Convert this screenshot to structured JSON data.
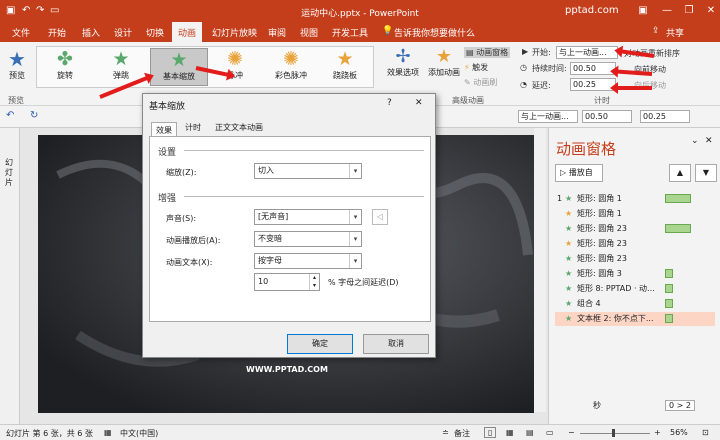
{
  "title": "运动中心.pptx - PowerPoint",
  "brand": "pptad.com",
  "share": "共享",
  "tabs": [
    "文件",
    "开始",
    "插入",
    "设计",
    "切换",
    "动画",
    "幻灯片放映",
    "审阅",
    "视图",
    "开发工具"
  ],
  "tell_me": "告诉我你想要做什么",
  "ribbon": {
    "preview": "预览",
    "preview_group": "预览",
    "animations": [
      {
        "label": "旋转",
        "color": "#5aa86c"
      },
      {
        "label": "弹跳",
        "color": "#5aa86c"
      },
      {
        "label": "基本缩放",
        "color": "#5aa86c"
      },
      {
        "label": "脉冲",
        "color": "#e8a33b"
      },
      {
        "label": "彩色脉冲",
        "color": "#e8a33b"
      },
      {
        "label": "跷跷板",
        "color": "#e8a33b"
      }
    ],
    "effect_options": "效果选项",
    "add_animation": "添加动画",
    "animation_pane": "动画窗格",
    "trigger": "触发",
    "anim_brush": "动画刷",
    "advanced_group": "高级动画",
    "start_label": "开始:",
    "start_value": "与上一动画...",
    "duration_label": "持续时间:",
    "duration_value": "00.50",
    "delay_label": "延迟:",
    "delay_value": "00.25",
    "reorder": "对动画重新排序",
    "move_earlier": "向前移动",
    "move_later": "向后移动",
    "timing_group": "计时"
  },
  "quickbar": {
    "start_value": "与上一动画...",
    "duration_value": "00.50",
    "delay_value": "00.25"
  },
  "left_strip": "幻灯片",
  "slide_text": "WWW.PPTAD.COM",
  "pane": {
    "title": "动画窗格",
    "play": "播放自",
    "items": [
      {
        "num": "1",
        "label": "矩形: 圆角 1",
        "color": "#5aa86c",
        "bar": true,
        "sel": false
      },
      {
        "num": "",
        "label": "矩形: 圆角 1",
        "color": "#e8a33b",
        "bar": false,
        "sel": false
      },
      {
        "num": "",
        "label": "矩形: 圆角 23",
        "color": "#5aa86c",
        "bar": true,
        "sel": false
      },
      {
        "num": "",
        "label": "矩形: 圆角 23",
        "color": "#e8a33b",
        "bar": false,
        "sel": false
      },
      {
        "num": "",
        "label": "矩形: 圆角 23",
        "color": "#5aa86c",
        "bar": false,
        "sel": false
      },
      {
        "num": "",
        "label": "矩形: 圆角 3",
        "color": "#5aa86c",
        "bar": true,
        "sel": false
      },
      {
        "num": "",
        "label": "矩形 8: PPTAD · 动...",
        "color": "#5aa86c",
        "bar": true,
        "sel": false
      },
      {
        "num": "",
        "label": "组合 4",
        "color": "#5aa86c",
        "bar": true,
        "sel": false
      },
      {
        "num": "",
        "label": "文本框 2: 你不点下...",
        "color": "#5aa86c",
        "bar": true,
        "sel": true
      }
    ],
    "seconds": "秒",
    "zoom_start": "0",
    "zoom_end": "2"
  },
  "dialog": {
    "title": "基本缩放",
    "help": "?",
    "tabs": [
      "效果",
      "计时",
      "正文文本动画"
    ],
    "settings": "设置",
    "zoom_label": "缩放(Z):",
    "zoom_value": "切入",
    "enhance": "增强",
    "sound_label": "声音(S):",
    "sound_value": "[无声音]",
    "after_label": "动画播放后(A):",
    "after_value": "不变暗",
    "text_label": "动画文本(X):",
    "text_value": "按字母",
    "delay_value": "10",
    "delay_suffix": "% 字母之间延迟(D)",
    "ok": "确定",
    "cancel": "取消"
  },
  "status": {
    "slide": "幻灯片 第 6 张，共 6 张",
    "lang": "中文(中国)",
    "notes": "备注",
    "zoom": "56%"
  }
}
